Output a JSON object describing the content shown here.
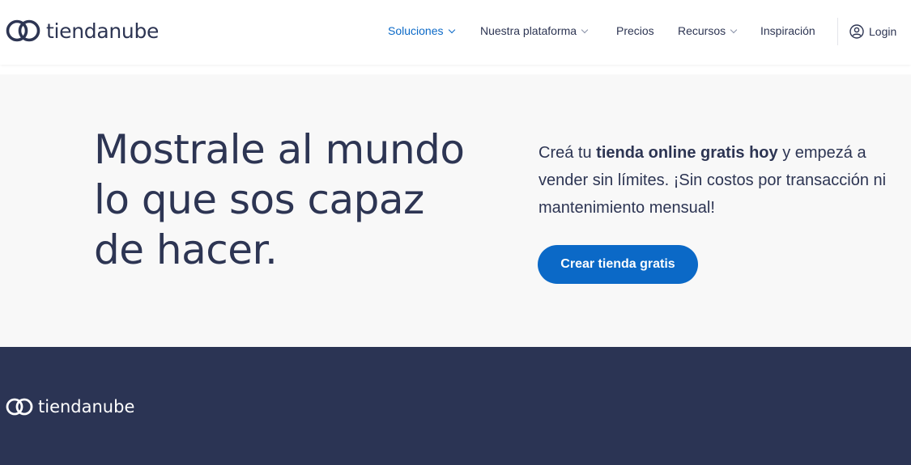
{
  "header": {
    "logo_text": "tiendanube",
    "nav": [
      {
        "label": "Soluciones",
        "has_dropdown": true,
        "active": true
      },
      {
        "label": "Nuestra plataforma",
        "has_dropdown": true,
        "active": false
      },
      {
        "label": "Precios",
        "has_dropdown": false,
        "active": false
      },
      {
        "label": "Recursos",
        "has_dropdown": true,
        "active": false
      },
      {
        "label": "Inspiración",
        "has_dropdown": false,
        "active": false
      }
    ],
    "login_label": "Login",
    "login_icon": "user-circle-icon"
  },
  "hero": {
    "title": "Mostrale al mundo lo que sos capaz de hacer.",
    "desc_part1": "Creá tu ",
    "desc_bold": "tienda online gratis hoy",
    "desc_part2": " y empezá a vender sin límites. ¡Sin costos por transacción ni mantenimiento mensual!",
    "cta_label": "Crear tienda gratis"
  },
  "footer": {
    "logo_text": "tiendanube"
  },
  "colors": {
    "brand_dark": "#2d3553",
    "accent_blue": "#0b69c7",
    "footer_bg": "#2b3454",
    "hero_bg": "#f8f8f8"
  }
}
